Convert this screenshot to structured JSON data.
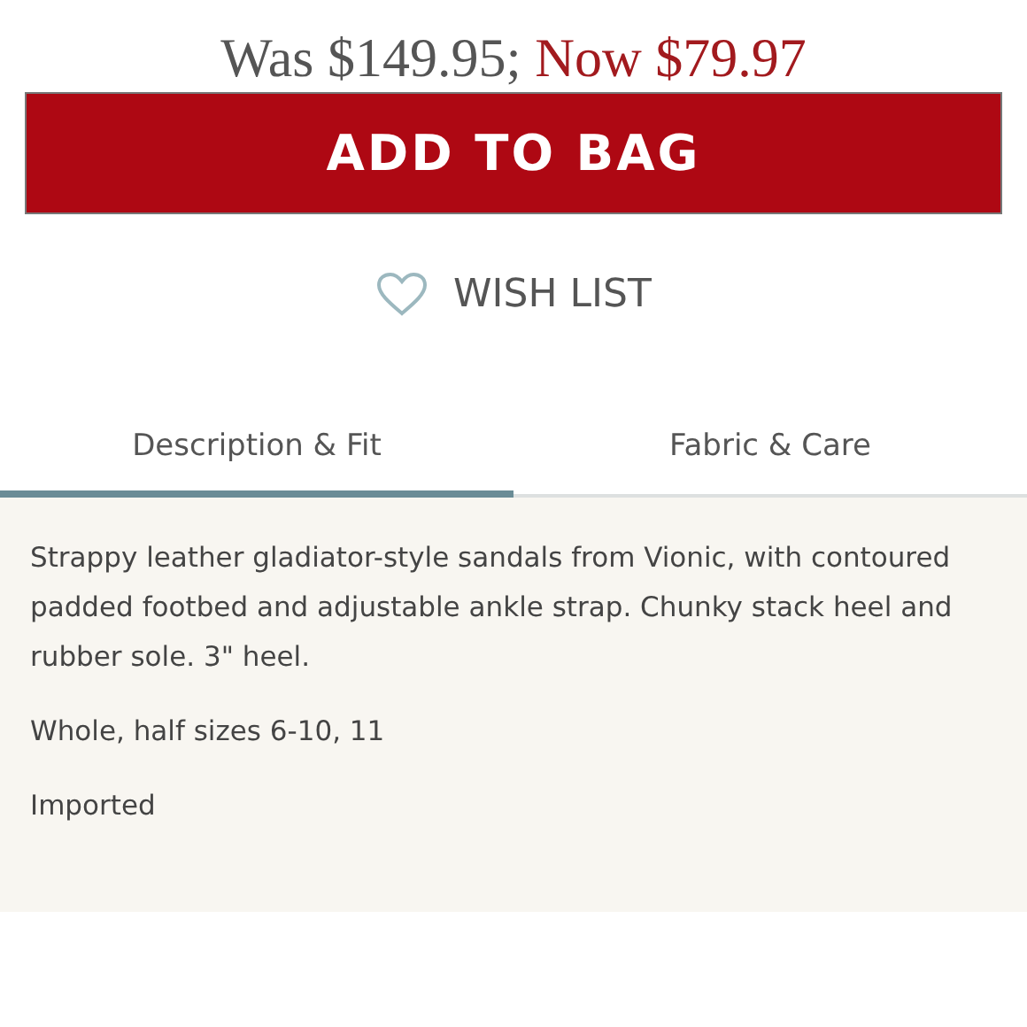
{
  "price": {
    "was": "Was $149.95;",
    "now": "Now $79.97"
  },
  "add_button": "ADD TO BAG",
  "wish_list": "WISH LIST",
  "tabs": [
    {
      "label": "Description & Fit",
      "selected": true
    },
    {
      "label": "Fabric & Care",
      "selected": false
    }
  ],
  "description": [
    "Strappy leather gladiator-style sandals from Vionic, with contoured padded footbed and adjustable ankle strap. Chunky stack heel and rubber sole. 3\" heel.",
    "Whole, half sizes 6-10, 11",
    "Imported"
  ]
}
